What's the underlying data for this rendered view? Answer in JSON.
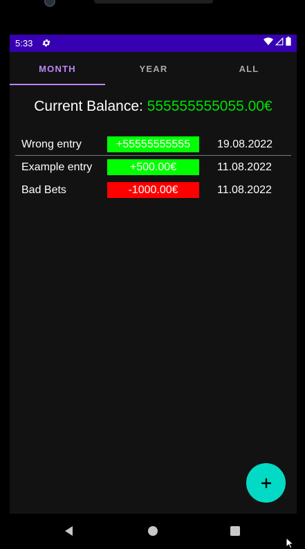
{
  "status_bar": {
    "time": "5:33",
    "icons": [
      "gear-icon",
      "wifi-icon",
      "signal-icon",
      "battery-icon"
    ]
  },
  "tabs": [
    {
      "label": "MONTH",
      "active": true
    },
    {
      "label": "YEAR",
      "active": false
    },
    {
      "label": "ALL",
      "active": false
    }
  ],
  "balance": {
    "label": "Current Balance: ",
    "value": "555555555055.00€"
  },
  "entries": [
    {
      "name": "Wrong entry",
      "amount": "+55555555555",
      "date": "19.08.2022",
      "type": "income"
    },
    {
      "name": "Example entry",
      "amount": "+500.00€",
      "date": "11.08.2022",
      "type": "income"
    },
    {
      "name": "Bad Bets",
      "amount": "-1000.00€",
      "date": "11.08.2022",
      "type": "expense"
    }
  ],
  "fab": {
    "icon": "plus-icon"
  },
  "nav": [
    "back-icon",
    "home-icon",
    "recents-icon"
  ],
  "colors": {
    "status_bar": "#3700b3",
    "accent": "#bb86fc",
    "income": "#00ff00",
    "expense": "#ff0000",
    "balance_value": "#00e000",
    "fab": "#03dac5",
    "background": "#121212"
  }
}
